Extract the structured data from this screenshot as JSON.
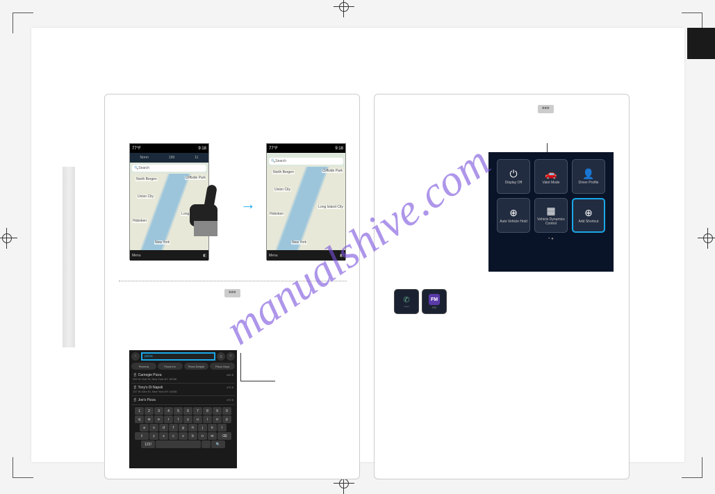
{
  "crop_marks": true,
  "watermark": "manualshive.com",
  "left_column": {
    "map_top": {
      "temp": "77°F",
      "time": "9:18",
      "modes": [
        "Norm",
        "199",
        "11"
      ],
      "search": "Search",
      "places": [
        "North Bergen",
        "Cliffside Park",
        "Union City",
        "Long Island City",
        "Hoboken",
        "New York"
      ],
      "menu": "Menu"
    },
    "tag": "***",
    "keyboard": {
      "input": "pizza",
      "chips": [
        "Pizzeria",
        "Pizza Inn",
        "Pizza Delight",
        "Pizza Guys"
      ],
      "results": [
        {
          "name": "Carnegie Pizza",
          "addr": "200 W 41st St, New York NY 10036",
          "dist": "440 ft"
        },
        {
          "name": "Tony's Di Napoli",
          "addr": "147 W 43rd St, New York NY 10036",
          "dist": "470 ft"
        },
        {
          "name": "Joe's Pizza",
          "addr": "",
          "dist": "470 ft"
        }
      ],
      "rows": [
        [
          "1",
          "2",
          "3",
          "4",
          "5",
          "6",
          "7",
          "8",
          "9",
          "0"
        ],
        [
          "q",
          "w",
          "e",
          "r",
          "t",
          "y",
          "u",
          "i",
          "o",
          "p"
        ],
        [
          "a",
          "s",
          "d",
          "f",
          "g",
          "h",
          "j",
          "k",
          "l"
        ],
        [
          "z",
          "x",
          "c",
          "v",
          "b",
          "n",
          "m"
        ]
      ]
    }
  },
  "right_column": {
    "tag": "***",
    "menu_tiles": [
      {
        "icon": "⏻",
        "label": "Display Off"
      },
      {
        "icon": "🚗",
        "label": "Valet Mode"
      },
      {
        "icon": "👤",
        "label": "Driver Profile"
      },
      {
        "icon": "⊕",
        "label": "Auto Vehicle Hold"
      },
      {
        "icon": "▦",
        "label": "Vehicle Dynamics Control"
      },
      {
        "icon": "⊕",
        "label": "Add Shortcut",
        "highlight": true
      }
    ],
    "small_icons": [
      {
        "icon": "✆",
        "label": "*****"
      },
      {
        "icon": "FM",
        "label": "FM",
        "fm": true
      }
    ]
  }
}
